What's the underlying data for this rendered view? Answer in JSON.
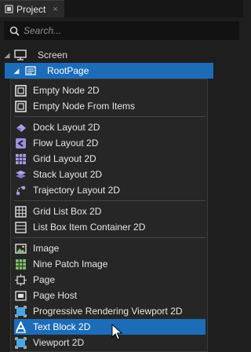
{
  "tab": {
    "label": "Project",
    "close": "×"
  },
  "search": {
    "placeholder": "Search..."
  },
  "tree": {
    "screen_label": "Screen",
    "root_label": "RootPage"
  },
  "menu": {
    "items": [
      {
        "label": "Empty Node 2D",
        "icon": "empty-node-icon"
      },
      {
        "label": "Empty Node From Items",
        "icon": "empty-node-icon"
      },
      {
        "label": "Dock Layout 2D",
        "icon": "dock-layout-icon"
      },
      {
        "label": "Flow Layout 2D",
        "icon": "flow-layout-icon"
      },
      {
        "label": "Grid Layout 2D",
        "icon": "grid-layout-icon"
      },
      {
        "label": "Stack Layout 2D",
        "icon": "stack-layout-icon"
      },
      {
        "label": "Trajectory Layout 2D",
        "icon": "trajectory-layout-icon"
      },
      {
        "label": "Grid List Box 2D",
        "icon": "grid-list-box-icon"
      },
      {
        "label": "List Box Item Container 2D",
        "icon": "list-box-icon"
      },
      {
        "label": "Image",
        "icon": "image-icon"
      },
      {
        "label": "Nine Patch Image",
        "icon": "nine-patch-icon"
      },
      {
        "label": "Page",
        "icon": "page-icon"
      },
      {
        "label": "Page Host",
        "icon": "page-host-icon"
      },
      {
        "label": "Progressive Rendering Viewport 2D",
        "icon": "viewport-icon"
      },
      {
        "label": "Text Block 2D",
        "icon": "text-block-icon"
      },
      {
        "label": "Viewport 2D",
        "icon": "viewport-icon"
      }
    ],
    "selected_index": 14
  },
  "colors": {
    "accent": "#1c6cb8",
    "background": "#1e1e1e",
    "menu": "#262626"
  }
}
